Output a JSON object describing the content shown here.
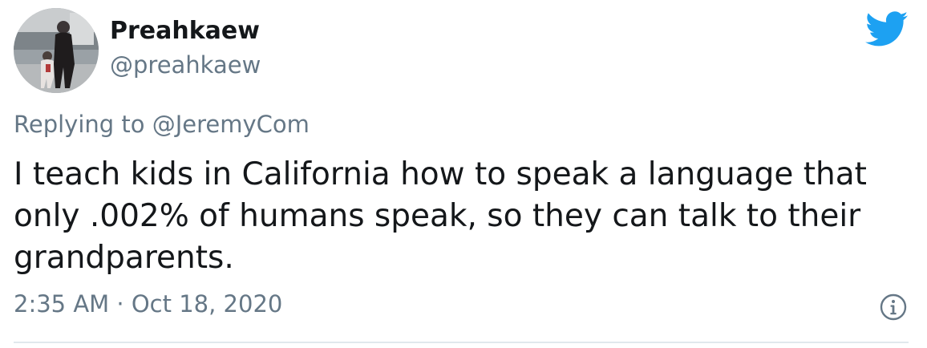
{
  "user": {
    "display_name": "Preahkaew",
    "handle": "@preahkaew",
    "avatar_icon": "profile-photo"
  },
  "reply": {
    "prefix": "Replying to",
    "mention": "@JeremyCom"
  },
  "tweet": {
    "text": "I teach kids in California how to speak a language that only .002% of humans speak, so they can talk to their grandparents.",
    "timestamp": "2:35 AM · Oct 18, 2020"
  },
  "icons": {
    "brand": "twitter-bird-icon",
    "info": "info-icon"
  },
  "colors": {
    "brand_blue": "#1da1f2",
    "secondary_text": "#657786",
    "primary_text": "#14171a",
    "divider": "#e1e8ed"
  }
}
